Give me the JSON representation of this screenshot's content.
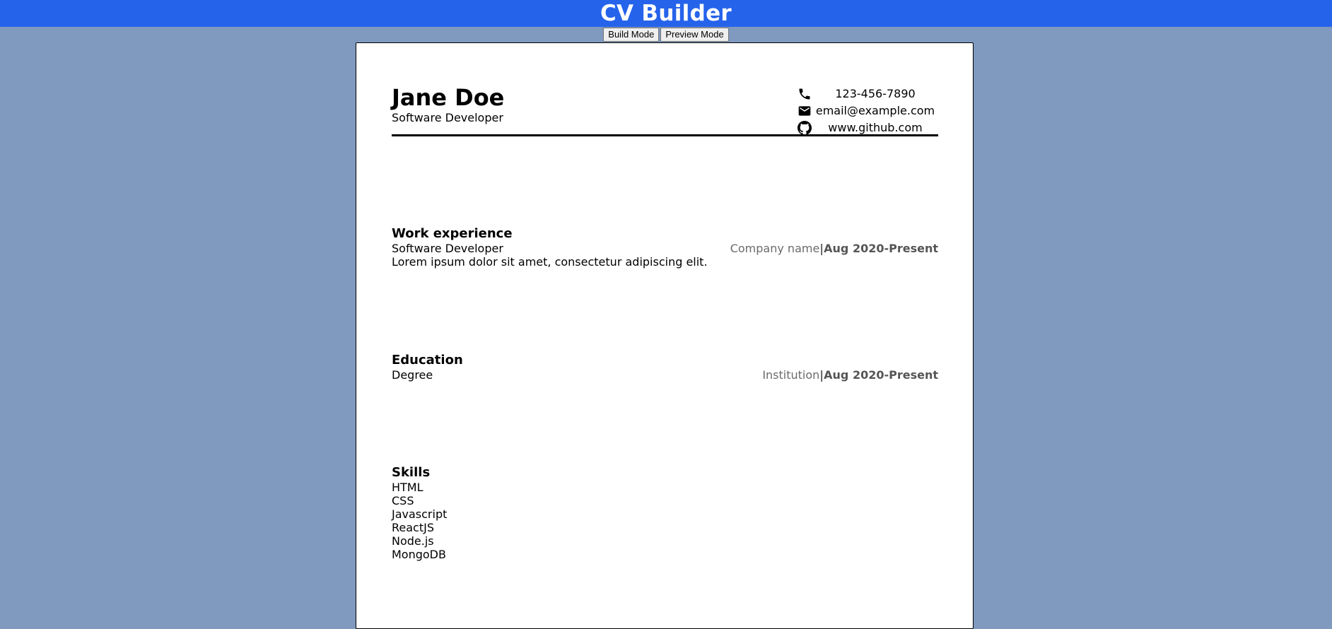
{
  "app": {
    "title": "CV Builder"
  },
  "modes": {
    "build_label": "Build Mode",
    "preview_label": "Preview Mode"
  },
  "cv": {
    "name": "Jane Doe",
    "title": "Software Developer",
    "contacts": {
      "phone": "123-456-7890",
      "email": "email@example.com",
      "website": "www.github.com"
    },
    "work": {
      "heading": "Work experience",
      "position": "Software Developer",
      "description": "Lorem ipsum dolor sit amet, consectetur adipiscing elit.",
      "company": "Company name",
      "separator": "|",
      "dates": "Aug 2020-Present"
    },
    "education": {
      "heading": "Education",
      "degree": "Degree",
      "institution": "Institution",
      "separator": "|",
      "dates": "Aug 2020-Present"
    },
    "skills": {
      "heading": "Skills",
      "items": [
        "HTML",
        "CSS",
        "Javascript",
        "ReactJS",
        "Node.js",
        "MongoDB"
      ]
    }
  },
  "icons": {
    "phone": "phone-icon",
    "email": "email-icon",
    "website": "github-icon"
  },
  "colors": {
    "header_bar": "#2563eb",
    "page_background": "#7f99bf",
    "sheet": "#ffffff",
    "meta_text": "#6b6b6b"
  }
}
